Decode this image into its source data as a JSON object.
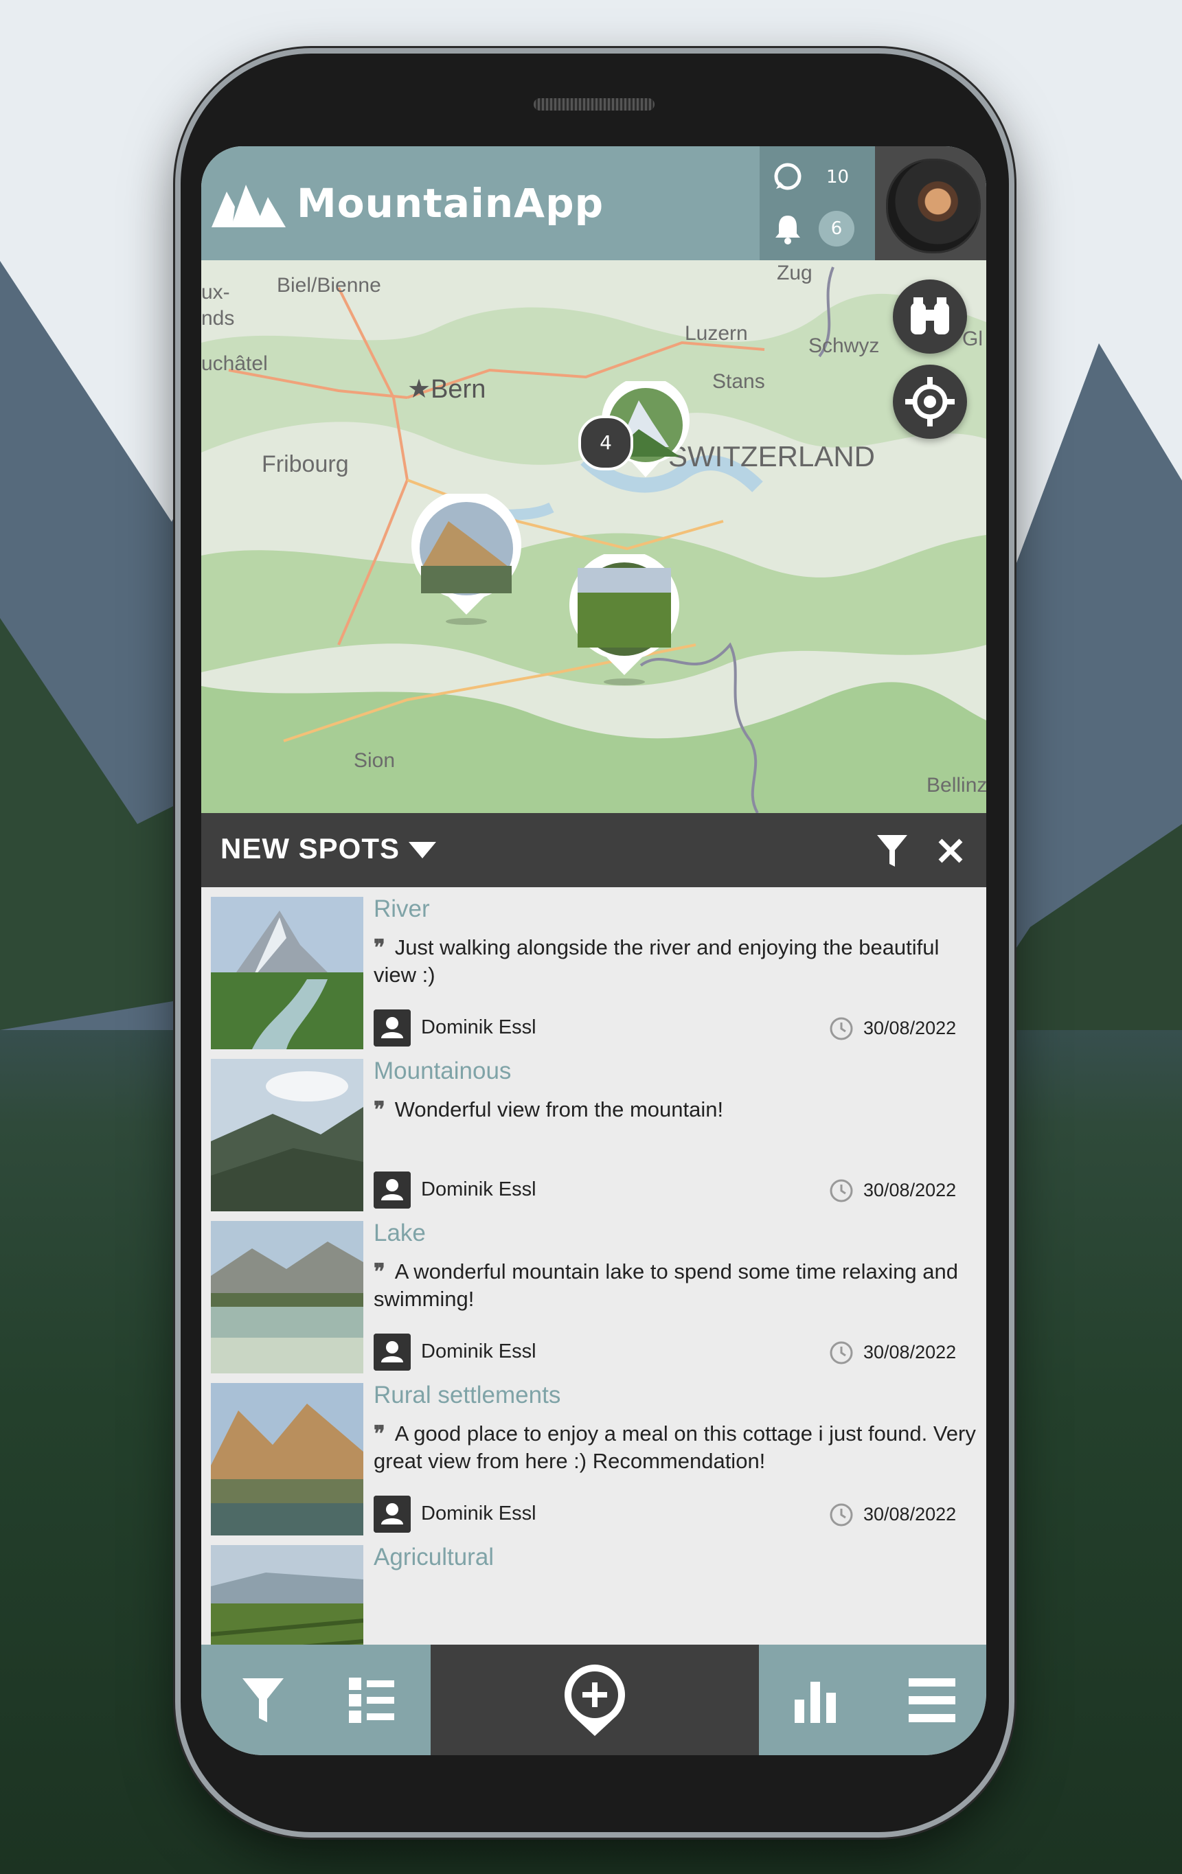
{
  "app": {
    "name": "MountainApp"
  },
  "header": {
    "stats": {
      "spots_count": "10",
      "notifications_count": "6"
    }
  },
  "map": {
    "labels": [
      "Biel/Bienne",
      "Bern",
      "Fribourg",
      "Luzern",
      "Schwyz",
      "Stans",
      "SWITZERLAND",
      "Zug",
      "Sion",
      "Bellinz",
      "uchâtel",
      "ux-",
      "nds",
      "Gl"
    ],
    "cluster_count": "4"
  },
  "list": {
    "title": "NEW SPOTS",
    "items": [
      {
        "title": "River",
        "description": "Just walking alongside the river and enjoying the beautiful view :)",
        "author": "Dominik Essl",
        "date": "30/08/2022"
      },
      {
        "title": "Mountainous",
        "description": "Wonderful view from the mountain!",
        "author": "Dominik Essl",
        "date": "30/08/2022"
      },
      {
        "title": "Lake",
        "description": "A wonderful mountain lake to spend some time relaxing and swimming!",
        "author": "Dominik Essl",
        "date": "30/08/2022"
      },
      {
        "title": "Rural settlements",
        "description": "A good place to enjoy a meal on this cottage i just found. Very great view from here :) Recommendation!",
        "author": "Dominik Essl",
        "date": "30/08/2022"
      },
      {
        "title": "Agricultural",
        "description": "",
        "author": "",
        "date": ""
      }
    ]
  },
  "icons": [
    "mountain-logo-icon",
    "spots-icon",
    "bell-icon",
    "binoculars-icon",
    "locate-icon",
    "dropdown-icon",
    "filter-icon",
    "close-icon",
    "quote-icon",
    "user-icon",
    "clock-icon",
    "list-icon",
    "add-spot-icon",
    "stats-icon",
    "menu-icon"
  ],
  "colors": {
    "accent": "#85a5a9",
    "accent_dark": "#6f8e92",
    "dark": "#3f3f3f",
    "title": "#7fa3a7"
  }
}
